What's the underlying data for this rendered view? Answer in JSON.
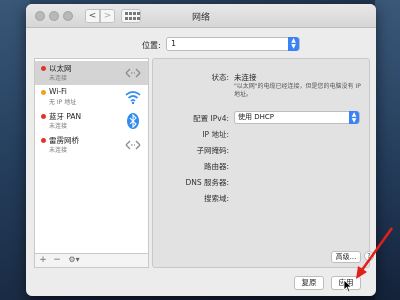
{
  "window": {
    "title": "网络"
  },
  "toolbar": {
    "back_glyph": "<",
    "forward_glyph": ">"
  },
  "location": {
    "label": "位置:",
    "value": "1"
  },
  "services": [
    {
      "name": "以太网",
      "status": "未连接",
      "dot_color": "#e5322d",
      "icon": "ethernet-arrows-icon"
    },
    {
      "name": "Wi-Fi",
      "status": "无 IP 地址",
      "dot_color": "#f0a020",
      "icon": "wifi-icon"
    },
    {
      "name": "蓝牙 PAN",
      "status": "未连接",
      "dot_color": "#e5322d",
      "icon": "bluetooth-icon"
    },
    {
      "name": "雷雳网桥",
      "status": "未连接",
      "dot_color": "#e5322d",
      "icon": "thunderbolt-arrows-icon"
    }
  ],
  "sidebar_footer": {
    "add": "+",
    "remove": "−",
    "action": "⚙▾"
  },
  "detail": {
    "status_label": "状态:",
    "status_value": "未连接",
    "status_desc": "\"以太网\"的电缆已经连接，但是您的电脑没有 IP 地址。",
    "config_label": "配置 IPv4:",
    "config_value": "使用 DHCP",
    "ip_label": "IP 地址:",
    "subnet_label": "子网掩码:",
    "router_label": "路由器:",
    "dns_label": "DNS 服务器:",
    "search_label": "搜索域:",
    "advanced_label": "高级...",
    "help_label": "?"
  },
  "footer": {
    "revert": "复原",
    "apply": "应用"
  },
  "colors": {
    "accent": "#3b82f6",
    "annotation_arrow": "#e0201b"
  }
}
